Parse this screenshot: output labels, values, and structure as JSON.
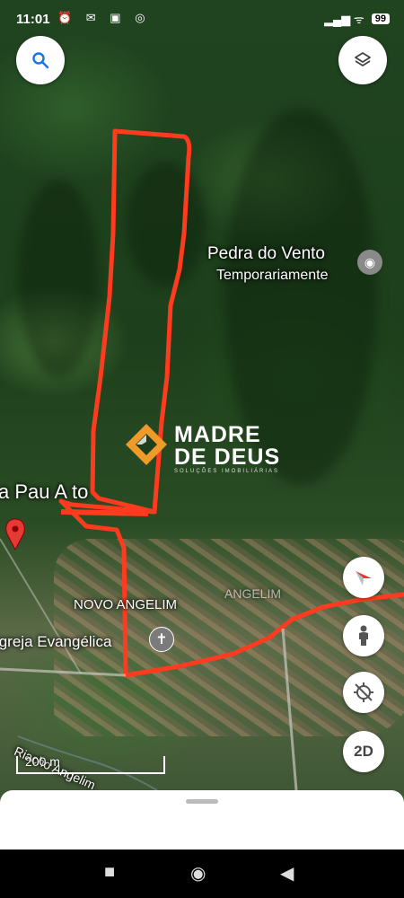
{
  "status_bar": {
    "time": "11:01",
    "left_icons": "⏰ ✉ ▣ ◎",
    "right_icons": "▂▄▆ ᯤ",
    "battery": "99"
  },
  "map": {
    "place_title": "Pedra do Vento",
    "place_subtitle": "Temporariamente",
    "area_label_left": "a Pau A to",
    "neighborhood_label": "NOVO ANGELIM",
    "neighborhood_label_faint": "ANGELIM",
    "church_label": "Igreja Evangélica",
    "river_label": "Riacho Angelim",
    "scale_label": "200 m",
    "route_color": "#ff3b1f"
  },
  "watermark": {
    "line1": "MADRE",
    "line2": "DE DEUS",
    "line3": "SOLUÇÕES IMOBILIÁRIAS"
  },
  "controls": {
    "search_icon": "search-icon",
    "layers_icon": "layers-icon",
    "compass_icon": "compass-icon",
    "pegman_icon": "pegman-icon",
    "location_icon": "location-off-icon",
    "view_mode": "2D"
  }
}
